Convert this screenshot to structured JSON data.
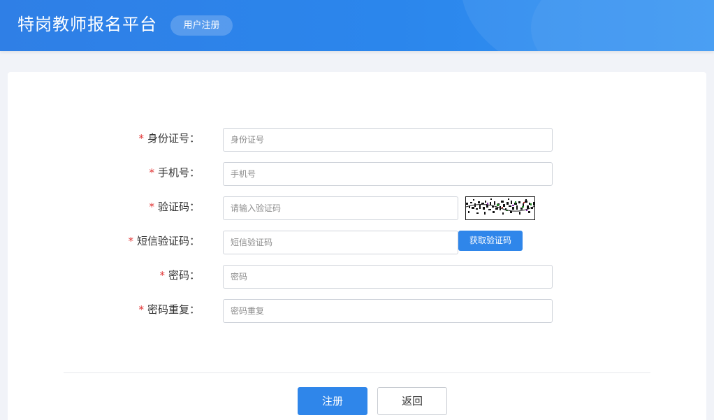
{
  "header": {
    "app_title": "特岗教师报名平台",
    "page_badge": "用户注册",
    "background_color": "#2f80e8"
  },
  "form": {
    "required_mark": "*",
    "fields": [
      {
        "label": "身份证号：",
        "placeholder": "身份证号",
        "value": ""
      },
      {
        "label": "手机号：",
        "placeholder": "手机号",
        "value": ""
      },
      {
        "label": "验证码：",
        "placeholder": "请输入验证码",
        "value": ""
      },
      {
        "label": "短信验证码：",
        "placeholder": "短信验证码",
        "value": ""
      },
      {
        "label": "密码：",
        "placeholder": "密码",
        "value": ""
      },
      {
        "label": "密码重复：",
        "placeholder": "密码重复",
        "value": ""
      }
    ],
    "sms_button_label": "获取验证码",
    "captcha_icon": "captcha-image-icon"
  },
  "actions": {
    "register_label": "注册",
    "back_label": "返回"
  },
  "colors": {
    "accent": "#2f86ea",
    "required": "#e03333",
    "page_bg": "#f1f3f8"
  }
}
